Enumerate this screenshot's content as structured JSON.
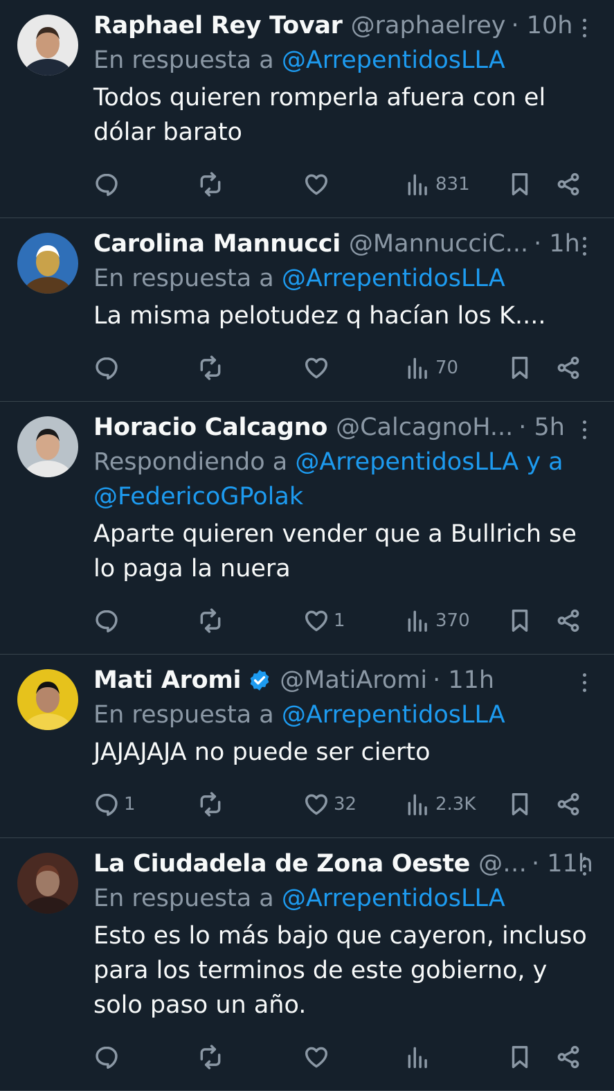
{
  "tweets": [
    {
      "name": "Raphael Rey Tovar",
      "handle": "@raphaelrey",
      "time": "· 10h",
      "verified": false,
      "reply_prefix": "En respuesta a ",
      "reply_to": "@ArrepentidosLLA",
      "reply_to_2": "",
      "text": "Todos quieren romperla afuera con el dólar barato",
      "replies": "",
      "retweets": "",
      "likes": "",
      "views": "831",
      "avatar": {
        "bg": "#e9e9e9",
        "skin": "#c99a7a",
        "suit": "#1f2a3a",
        "hair": "#3a2a20"
      }
    },
    {
      "name": "Carolina Mannucci",
      "handle": "@MannucciC...",
      "time": "· 1h",
      "verified": false,
      "reply_prefix": "En respuesta a ",
      "reply_to": "@ArrepentidosLLA",
      "reply_to_2": "",
      "text": "La misma pelotudez q hacían los K....",
      "replies": "",
      "retweets": "",
      "likes": "",
      "views": "70",
      "avatar": {
        "bg": "#2f6fb8",
        "skin": "#c9a24a",
        "suit": "#5a3b1e",
        "hair": "#ffffff"
      }
    },
    {
      "name": "Horacio Calcagno",
      "handle": "@CalcagnoH...",
      "time": "· 5h",
      "verified": false,
      "reply_prefix": "Respondiendo a ",
      "reply_to": "@ArrepentidosLLA y a",
      "reply_to_2": "@FedericoGPolak",
      "text": "Aparte quieren vender que a Bullrich se lo paga la nuera",
      "replies": "",
      "retweets": "",
      "likes": "1",
      "views": "370",
      "avatar": {
        "bg": "#b9c2c9",
        "skin": "#d3a88a",
        "suit": "#e8e8e8",
        "hair": "#1a1a1a"
      }
    },
    {
      "name": "Mati Aromi",
      "handle": "@MatiAromi",
      "time": "· 11h",
      "verified": true,
      "reply_prefix": "En respuesta a ",
      "reply_to": "@ArrepentidosLLA",
      "reply_to_2": "",
      "text": "JAJAJAJA no puede ser cierto",
      "replies": "1",
      "retweets": "",
      "likes": "32",
      "views": "2.3K",
      "avatar": {
        "bg": "#e6c21c",
        "skin": "#b5866a",
        "suit": "#f2d34a",
        "hair": "#111111"
      }
    },
    {
      "name": "La Ciudadela de Zona Oeste",
      "handle": "@l...",
      "time": "· 11h",
      "verified": false,
      "reply_prefix": "En respuesta a ",
      "reply_to": "@ArrepentidosLLA",
      "reply_to_2": "",
      "text": "Esto es lo más bajo que cayeron, incluso para los terminos de este gobierno, y solo paso un año.",
      "replies": "",
      "retweets": "",
      "likes": "",
      "views": "",
      "avatar": {
        "bg": "#4a2a22",
        "skin": "#9e7a66",
        "suit": "#2a1a18",
        "hair": "#6b3a2a"
      }
    }
  ],
  "colors": {
    "background": "#15202b",
    "link": "#1d9bf0",
    "muted": "#8b98a5",
    "divider": "#38444d",
    "verified": "#1d9bf0"
  },
  "icons": [
    "reply-icon",
    "retweet-icon",
    "like-icon",
    "views-icon",
    "bookmark-icon",
    "share-icon",
    "more-icon",
    "verified-badge-icon"
  ]
}
